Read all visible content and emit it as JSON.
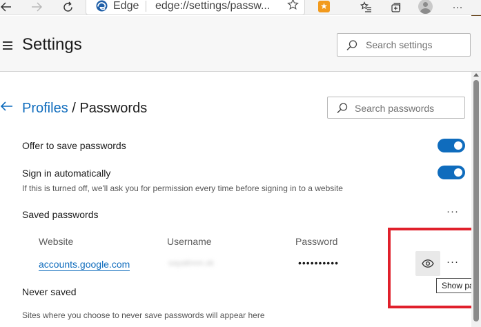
{
  "browser": {
    "brand": "Edge",
    "url": "edge://settings/passw...",
    "back_icon": "arrow-left-icon",
    "forward_icon": "arrow-right-icon",
    "refresh_icon": "refresh-icon",
    "favorite_icon": "star-outline-icon",
    "extension_icon": "extension-icon",
    "favorites_bar_icon": "favorites-list-icon",
    "collections_icon": "collections-icon",
    "menu_label": "···",
    "extension_color": "#f29a1d"
  },
  "settings": {
    "title": "Settings",
    "search_placeholder": "Search settings"
  },
  "page": {
    "breadcrumb_parent": "Profiles",
    "breadcrumb_separator": "/",
    "breadcrumb_current": "Passwords",
    "search_placeholder": "Search passwords",
    "accent_color": "#0f6cbd"
  },
  "options": [
    {
      "label": "Offer to save passwords",
      "enabled": true
    },
    {
      "label": "Sign in automatically",
      "enabled": true,
      "description": "If this is turned off, we'll ask you for permission every time before signing in to a website"
    }
  ],
  "saved_passwords": {
    "heading": "Saved passwords",
    "more_label": "···",
    "columns": {
      "website": "Website",
      "username": "Username",
      "password": "Password"
    },
    "rows": [
      {
        "website": "accounts.google.com",
        "username": "sayalinnn.sk",
        "password": "••••••••••",
        "more_label": "···"
      }
    ],
    "show_tooltip": "Show password"
  },
  "never_saved": {
    "heading": "Never saved",
    "description": "Sites where you choose to never save passwords will appear here"
  },
  "annotation_color": "#e0202b"
}
